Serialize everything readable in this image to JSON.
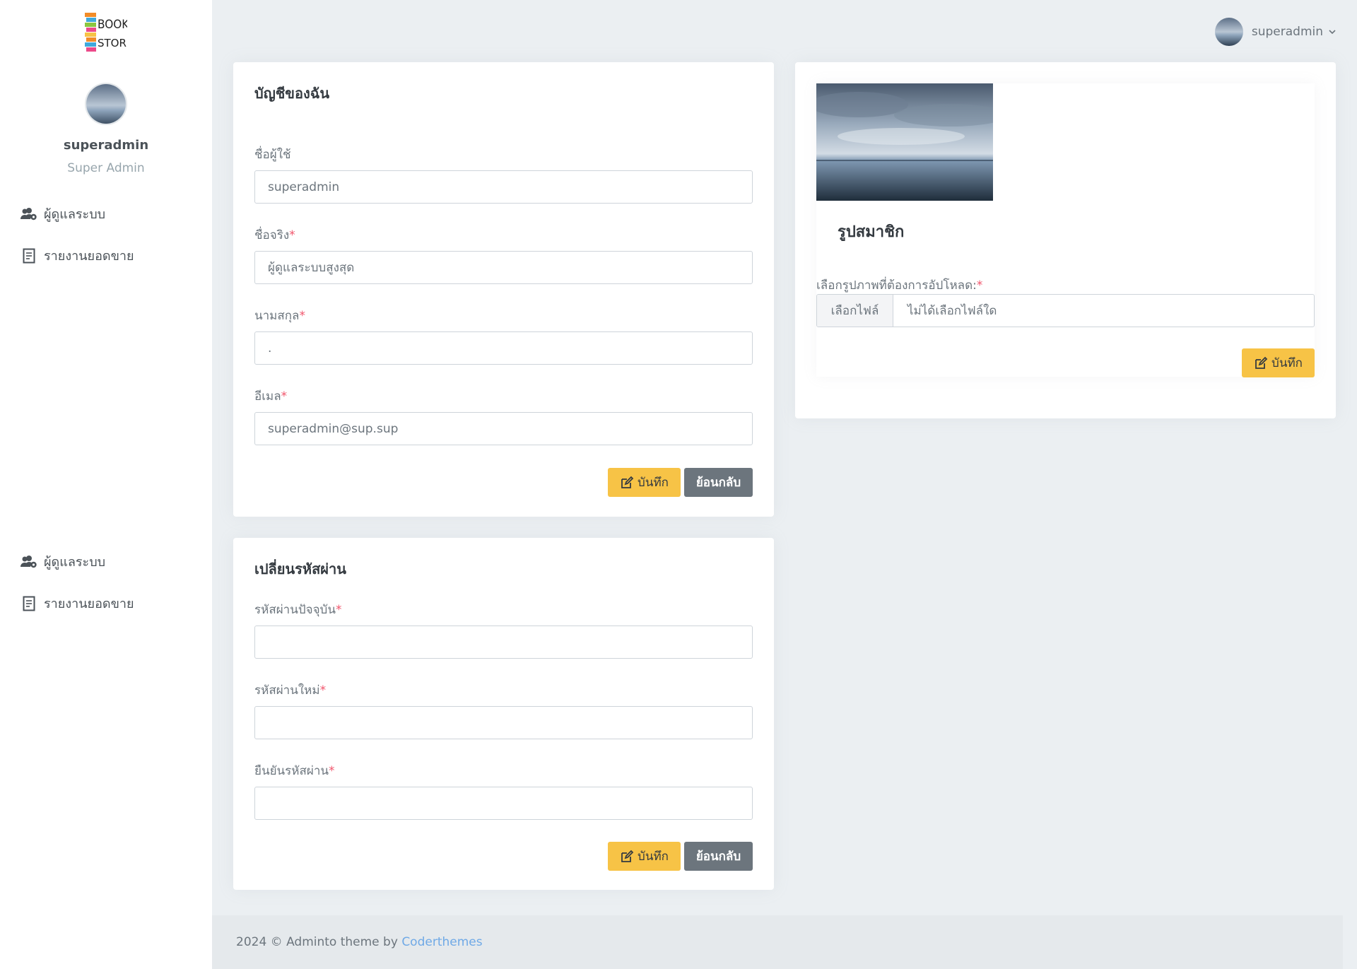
{
  "sidebar": {
    "username": "superadmin",
    "role": "Super Admin",
    "menu_top": [
      {
        "label": "ผู้ดูแลระบบ",
        "icon": "users-cog-icon"
      },
      {
        "label": "รายงานยอดขาย",
        "icon": "receipt-icon"
      }
    ],
    "menu_bottom": [
      {
        "label": "ผู้ดูแลระบบ",
        "icon": "users-cog-icon"
      },
      {
        "label": "รายงานยอดขาย",
        "icon": "receipt-icon"
      }
    ]
  },
  "topbar": {
    "username": "superadmin"
  },
  "account": {
    "title": "บัญชีของฉัน",
    "fields": {
      "username": {
        "label": "ชื่อผู้ใช้",
        "value": "superadmin"
      },
      "firstname": {
        "label": "ชื่อจริง",
        "value": "ผู้ดูแลระบบสูงสุด"
      },
      "lastname": {
        "label": "นามสกุล",
        "value": "."
      },
      "email": {
        "label": "อีเมล",
        "value": "superadmin@sup.sup"
      }
    },
    "save_label": "บันทึก",
    "back_label": "ย้อนกลับ"
  },
  "password": {
    "title": "เปลี่ยนรหัสผ่าน",
    "fields": {
      "current": {
        "label": "รหัสผ่านปัจจุบัน",
        "value": ""
      },
      "new": {
        "label": "รหัสผ่านใหม่",
        "value": ""
      },
      "confirm": {
        "label": "ยืนยันรหัสผ่าน",
        "value": ""
      }
    },
    "save_label": "บันทึก",
    "back_label": "ย้อนกลับ"
  },
  "picture": {
    "title": "รูปสมาชิก",
    "upload_label": "เลือกรูปภาพที่ต้องการอัปโหลด:",
    "file_button": "เลือกไฟล์",
    "file_status": "ไม่ได้เลือกไฟล์ใด",
    "save_label": "บันทึก"
  },
  "footer": {
    "text": "2024 © Adminto theme by",
    "link": "Coderthemes"
  },
  "colors": {
    "accent_warning": "#f7c346",
    "secondary": "#6c757d",
    "required": "#f1556c",
    "link": "#6fa9e6",
    "background": "#ebeff2"
  },
  "logo": {
    "line1": "BOOK",
    "line2": "STORE"
  },
  "required_mark": "*"
}
